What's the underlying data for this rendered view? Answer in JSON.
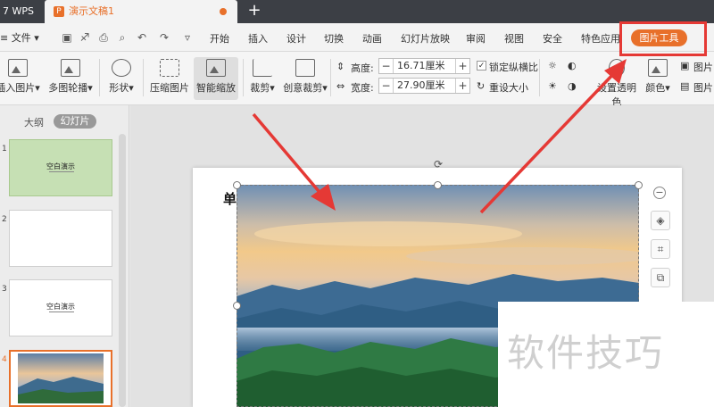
{
  "titlebar": {
    "app": "7 WPS",
    "doc_title": "演示文稿1",
    "doc_icon": "P",
    "add_tab": "+"
  },
  "menubar": {
    "file": "≡ 文件 ▾",
    "items": [
      "开始",
      "插入",
      "设计",
      "切换",
      "动画",
      "幻灯片放映",
      "审阅",
      "视图",
      "安全",
      "特色应用"
    ],
    "active": "图片工具"
  },
  "ribbon": {
    "insert_image": "插入图片▾",
    "multi_carousel": "多图轮播▾",
    "shape": "形状▾",
    "compress": "压缩图片",
    "smart_zoom": "智能缩放",
    "crop": "裁剪▾",
    "creative_crop": "创意裁剪▾",
    "height_label": "高度:",
    "height_value": "16.71厘米",
    "width_label": "宽度:",
    "width_value": "27.90厘米",
    "lock_ratio": "锁定纵横比",
    "reset_size": "重设大小",
    "transparent": "设置透明色",
    "color": "颜色▾",
    "picture_label": "图片"
  },
  "left_panel": {
    "tab_outline": "大纲",
    "tab_slides": "幻灯片",
    "thumbs": [
      {
        "num": "1",
        "text": "空白演示"
      },
      {
        "num": "2",
        "text": ""
      },
      {
        "num": "3",
        "text": "空白演示"
      },
      {
        "num": "4",
        "text": ""
      }
    ]
  },
  "slide": {
    "title_fragment": "单"
  },
  "watermark": "软件技巧",
  "colors": {
    "accent": "#e8702a",
    "highlight": "#e53935",
    "titlebar": "#3c3f45"
  }
}
